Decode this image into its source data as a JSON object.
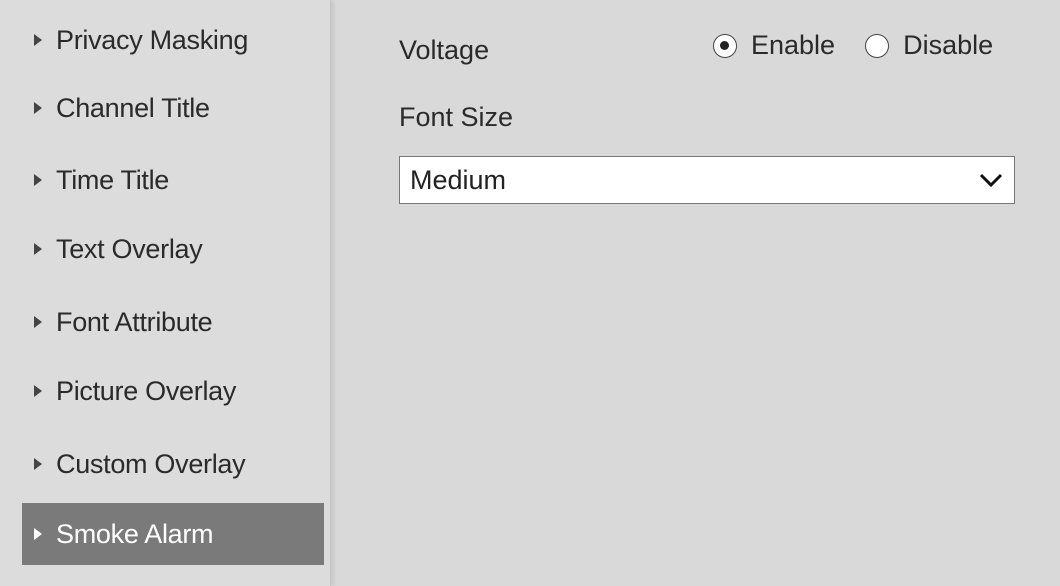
{
  "sidebar": {
    "items": [
      {
        "label": "Privacy Masking"
      },
      {
        "label": "Channel Title"
      },
      {
        "label": "Time Title"
      },
      {
        "label": "Text Overlay"
      },
      {
        "label": "Font Attribute"
      },
      {
        "label": "Picture Overlay"
      },
      {
        "label": "Custom Overlay"
      },
      {
        "label": "Smoke Alarm",
        "active": true
      }
    ]
  },
  "main": {
    "voltage_label": "Voltage",
    "voltage_options": {
      "enable": "Enable",
      "disable": "Disable",
      "selected": "Enable"
    },
    "font_size_label": "Font Size",
    "font_size_select": {
      "value": "Medium"
    }
  },
  "colors": {
    "active_bg": "#7a7a7a",
    "panel_bg": "#d9d9d9"
  },
  "icons": [
    "triangle-right-icon",
    "radio-checked-icon",
    "radio-unchecked-icon",
    "chevron-down-icon"
  ]
}
